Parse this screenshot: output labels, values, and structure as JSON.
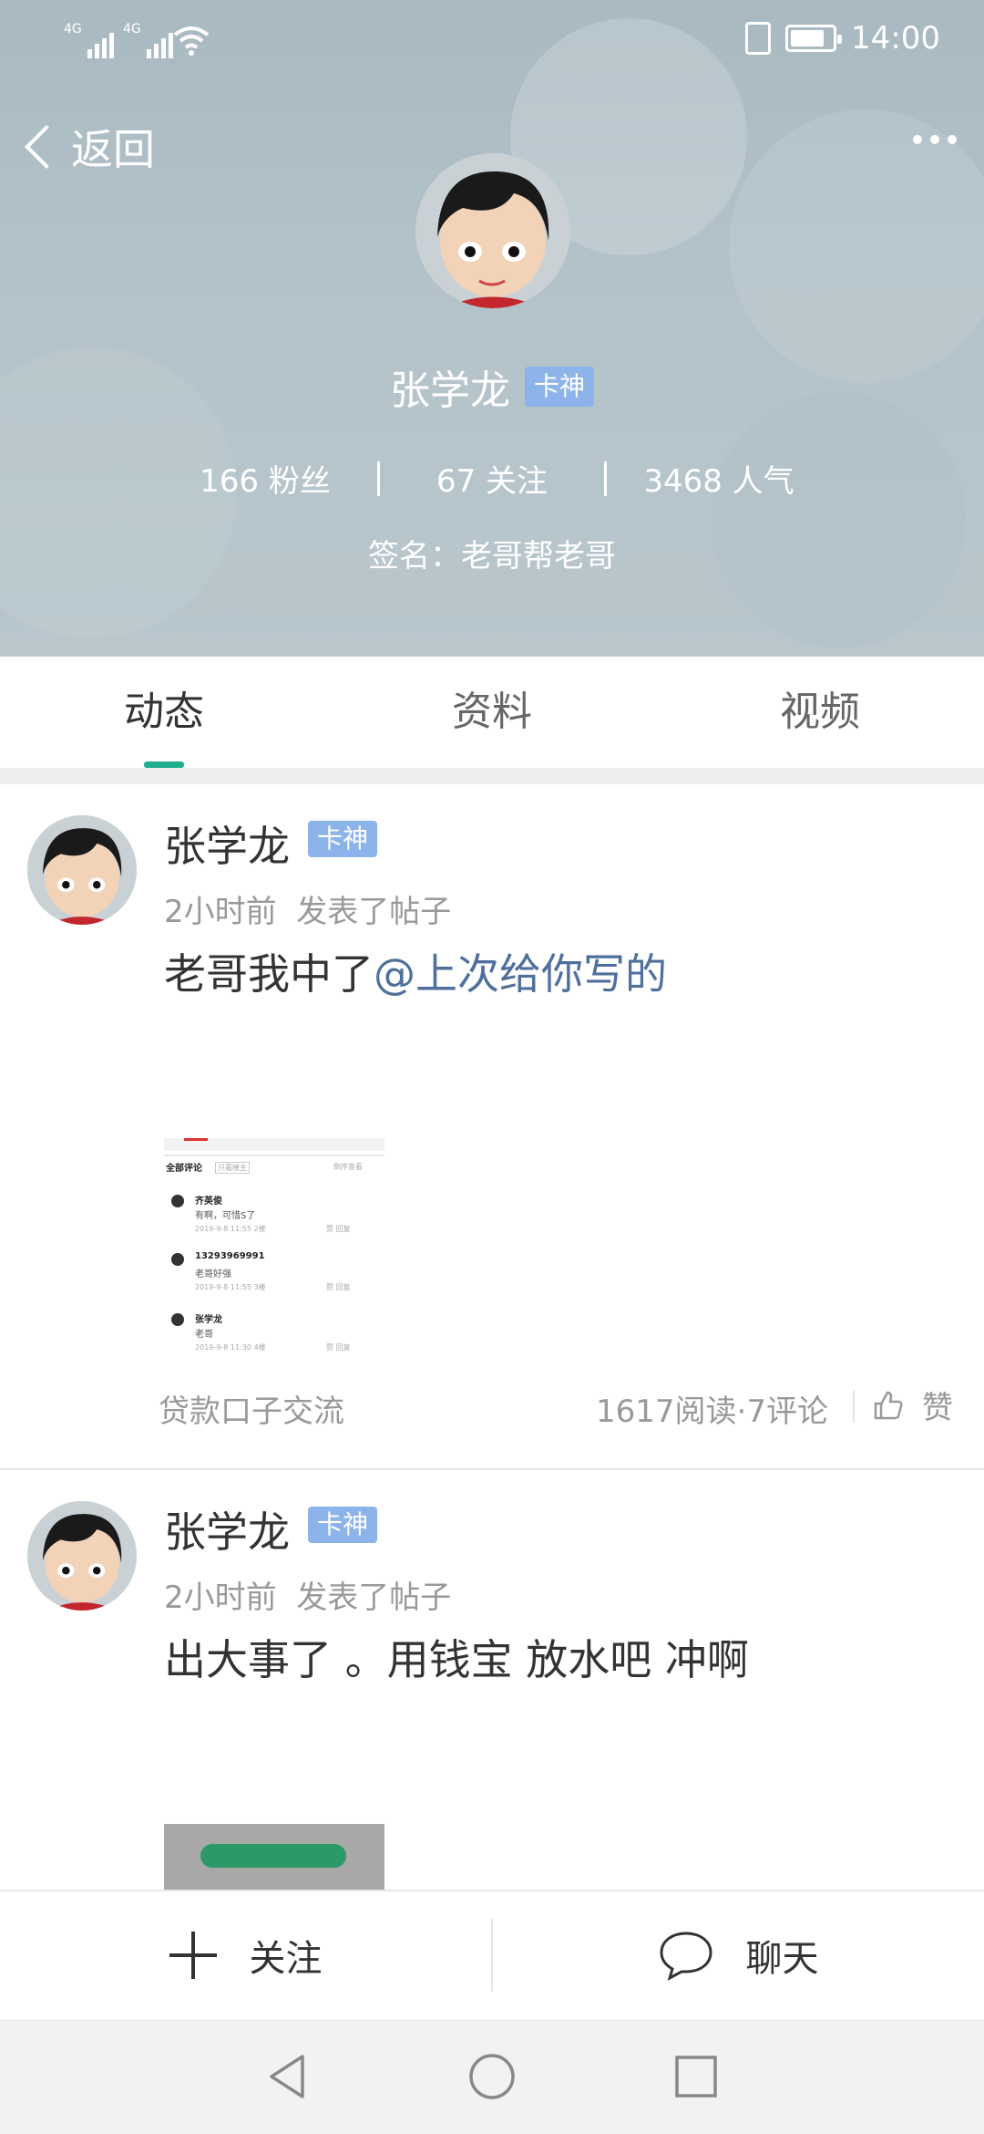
{
  "status_bar": {
    "network_1": "4G",
    "network_2": "4G",
    "time": "14:00",
    "icons": [
      "signal-icon",
      "signal-icon",
      "wifi-icon",
      "vibrate-icon",
      "battery-icon"
    ]
  },
  "header": {
    "back_label": "返回",
    "more_icon": "more-dots-icon",
    "name": "张学龙",
    "badge": "卡神",
    "stats": [
      {
        "value": "166",
        "label": "粉丝"
      },
      {
        "value": "67",
        "label": "关注"
      },
      {
        "value": "3468",
        "label": "人气"
      }
    ],
    "signature": "签名：老哥帮老哥"
  },
  "tabs": [
    "动态",
    "资料",
    "视频"
  ],
  "active_tab": "动态",
  "posts": [
    {
      "name": "张学龙",
      "badge": "卡神",
      "time": "2小时前",
      "action": "发表了帖子",
      "text": "老哥我中了",
      "mention": "@上次给你写的",
      "forum": "贷款口子交流",
      "stats": "1617阅读·7评论",
      "like_label": "赞",
      "thumbnail": {
        "header": "全部评论",
        "header_tag": "只看楼主",
        "sort": "倒序查看",
        "comments": [
          {
            "user": "齐英俊",
            "text": "有啊，可惜S了",
            "meta": "2019-9-8 11:55  2楼",
            "actions": "赞  回复"
          },
          {
            "user": "13293969991",
            "text": "老哥好强",
            "meta": "2019-9-8 11:55  3楼",
            "actions": "赞  回复"
          },
          {
            "user": "张学龙",
            "text": "老哥",
            "meta": "2019-9-8 11:30  4楼",
            "actions": "赞  回复"
          }
        ]
      }
    },
    {
      "name": "张学龙",
      "badge": "卡神",
      "time": "2小时前",
      "action": "发表了帖子",
      "text": "出大事了  。用钱宝  放水吧  冲啊"
    }
  ],
  "actions": {
    "follow": "关注",
    "chat": "聊天"
  },
  "colors": {
    "accent": "#1fae8e",
    "badge": "#8cb3ea",
    "mention": "#4f6f9c",
    "header_bg": "#b3c2c9"
  }
}
